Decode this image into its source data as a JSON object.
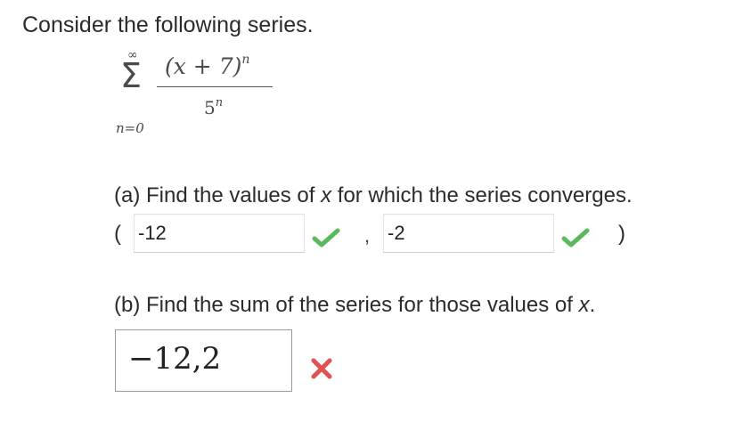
{
  "intro": "Consider the following series.",
  "series": {
    "sigma_upper": "∞",
    "sigma": "Σ",
    "sigma_lower": "n=0",
    "numerator": "(x + 7)",
    "numerator_exp": "n",
    "denominator": "5",
    "denominator_exp": "n"
  },
  "part_a": {
    "prefix": "(a) Find the values of ",
    "var": "x",
    "suffix": " for which the series converges.",
    "open_paren": "(",
    "close_paren": ")",
    "separator": ",",
    "lower_value": "-12",
    "upper_value": "-2",
    "lower_status": "correct",
    "upper_status": "correct"
  },
  "part_b": {
    "prefix": "(b) Find the sum of the series for those values of ",
    "var": "x",
    "suffix": ".",
    "answer": "−12,2",
    "status": "incorrect"
  },
  "colors": {
    "correct": "#5cb85c",
    "incorrect": "#e05252"
  },
  "icons": {
    "correct": "check-icon",
    "incorrect": "x-icon"
  }
}
